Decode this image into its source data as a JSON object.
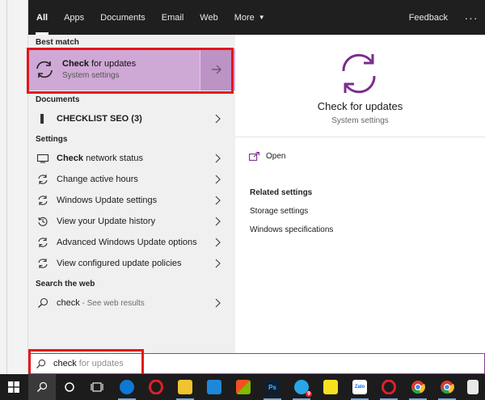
{
  "filters": {
    "tabs": [
      {
        "label": "All",
        "active": true
      },
      {
        "label": "Apps",
        "active": false
      },
      {
        "label": "Documents",
        "active": false
      },
      {
        "label": "Email",
        "active": false
      },
      {
        "label": "Web",
        "active": false
      },
      {
        "label": "More",
        "active": false
      }
    ],
    "feedback": "Feedback",
    "more_options": "···"
  },
  "left": {
    "best_match_header": "Best match",
    "best_match": {
      "title_bold": "Check",
      "title_rest": " for updates",
      "subtitle": "System settings"
    },
    "documents_header": "Documents",
    "documents": [
      {
        "bold": "CHECK",
        "rest": "LIST SEO (3)"
      }
    ],
    "settings_header": "Settings",
    "settings": [
      {
        "bold": "Check",
        "rest": " network status",
        "icon": "network-icon"
      },
      {
        "bold": "",
        "rest": "Change active hours",
        "icon": "refresh-icon"
      },
      {
        "bold": "",
        "rest": "Windows Update settings",
        "icon": "refresh-icon"
      },
      {
        "bold": "",
        "rest": "View your Update history",
        "icon": "history-icon"
      },
      {
        "bold": "",
        "rest": "Advanced Windows Update options",
        "icon": "refresh-icon"
      },
      {
        "bold": "",
        "rest": "View configured update policies",
        "icon": "refresh-icon"
      }
    ],
    "web_header": "Search the web",
    "web": {
      "query": "check",
      "hint": " - See web results"
    }
  },
  "right": {
    "title": "Check for updates",
    "subtitle": "System settings",
    "open_label": "Open",
    "related_header": "Related settings",
    "related": [
      "Storage settings",
      "Windows specifications"
    ]
  },
  "search": {
    "typed": "check",
    "suggestion": "for updates"
  },
  "taskbar": {
    "ps_label": "Ps",
    "zalo_label": "Zalo",
    "badge": "9"
  },
  "colors": {
    "accent": "#7b2d8e",
    "highlight": "#cfa9d6",
    "red_box": "#e2161c"
  }
}
